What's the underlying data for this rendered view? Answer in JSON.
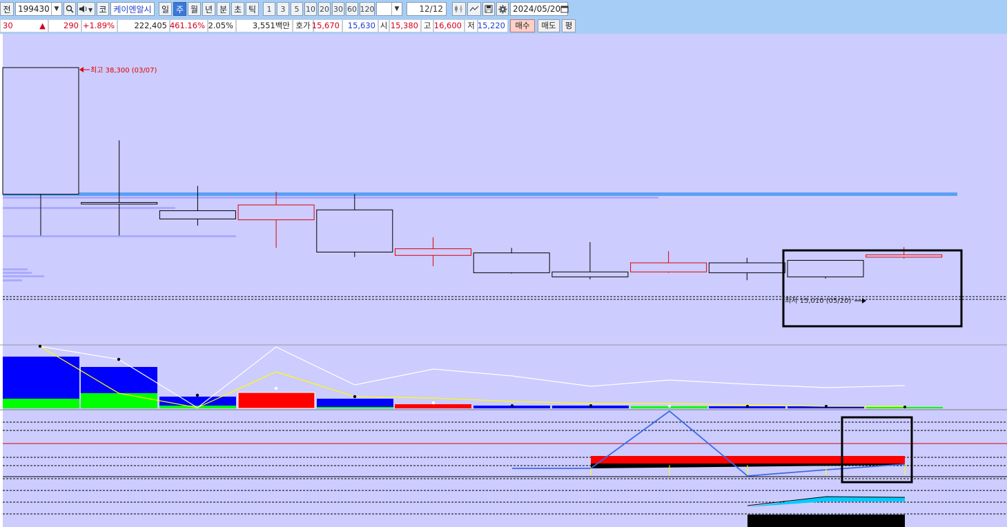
{
  "toolbar": {
    "mode_label": "전",
    "stock_code": "199430",
    "market_badge": "코",
    "stock_name": "케이엔알시",
    "period_tabs": [
      "일",
      "주",
      "월",
      "년",
      "분",
      "초",
      "틱"
    ],
    "active_period": "주",
    "interval_buttons": [
      "1",
      "3",
      "5",
      "10",
      "20",
      "30",
      "60",
      "120"
    ],
    "page_counter": "12/12",
    "date_value": "2024/05/20"
  },
  "quote": {
    "price_fragment": "30",
    "change_arrow": "▲",
    "change": "290",
    "change_pct": "+1.89%",
    "volume": "222,405",
    "volume_ratio": "461.16%",
    "turnover_pct": "2.05%",
    "amount": "3,551백만",
    "bid_label": "호가",
    "ask_price": "15,670",
    "bid_price": "15,630",
    "open_label": "시",
    "open": "15,380",
    "high_label": "고",
    "high": "16,600",
    "low_label": "저",
    "low": "15,220",
    "buy_label": "매수",
    "sell_label": "매도",
    "eval_label": "평"
  },
  "annotations": {
    "high_marker": "최고 38,300 (03/07)",
    "low_marker": "최저 15,010 (05/20)"
  },
  "colors": {
    "up": "#e00000",
    "down": "#000000",
    "chart_bg": "#ccccff",
    "header_bg": "#a6cdf5"
  },
  "chart_data": {
    "type": "candlestick",
    "period": "weekly",
    "candles": [
      {
        "open": 38300,
        "close": 23000,
        "high": 38300,
        "low": 18000,
        "dir": "down"
      },
      {
        "open": 22000,
        "close": 21800,
        "high": 29500,
        "low": 18000,
        "dir": "down"
      },
      {
        "open": 21000,
        "close": 20000,
        "high": 24000,
        "low": 19200,
        "dir": "down"
      },
      {
        "open": 19900,
        "close": 21700,
        "high": 23300,
        "low": 16500,
        "dir": "up"
      },
      {
        "open": 21100,
        "close": 16000,
        "high": 23000,
        "low": 15400,
        "dir": "down"
      },
      {
        "open": 15600,
        "close": 16400,
        "high": 17800,
        "low": 14300,
        "dir": "up"
      },
      {
        "open": 15900,
        "close": 13500,
        "high": 16500,
        "low": 13400,
        "dir": "down"
      },
      {
        "open": 13600,
        "close": 13000,
        "high": 17200,
        "low": 12700,
        "dir": "down"
      },
      {
        "open": 13600,
        "close": 14700,
        "high": 16100,
        "low": 13500,
        "dir": "up"
      },
      {
        "open": 14700,
        "close": 13500,
        "high": 15300,
        "low": 12600,
        "dir": "down"
      },
      {
        "open": 15000,
        "close": 13000,
        "high": 13200,
        "low": 12800,
        "dir": "down"
      },
      {
        "open": 15380,
        "close": 15670,
        "high": 16600,
        "low": 15220,
        "dir": "up"
      }
    ]
  }
}
